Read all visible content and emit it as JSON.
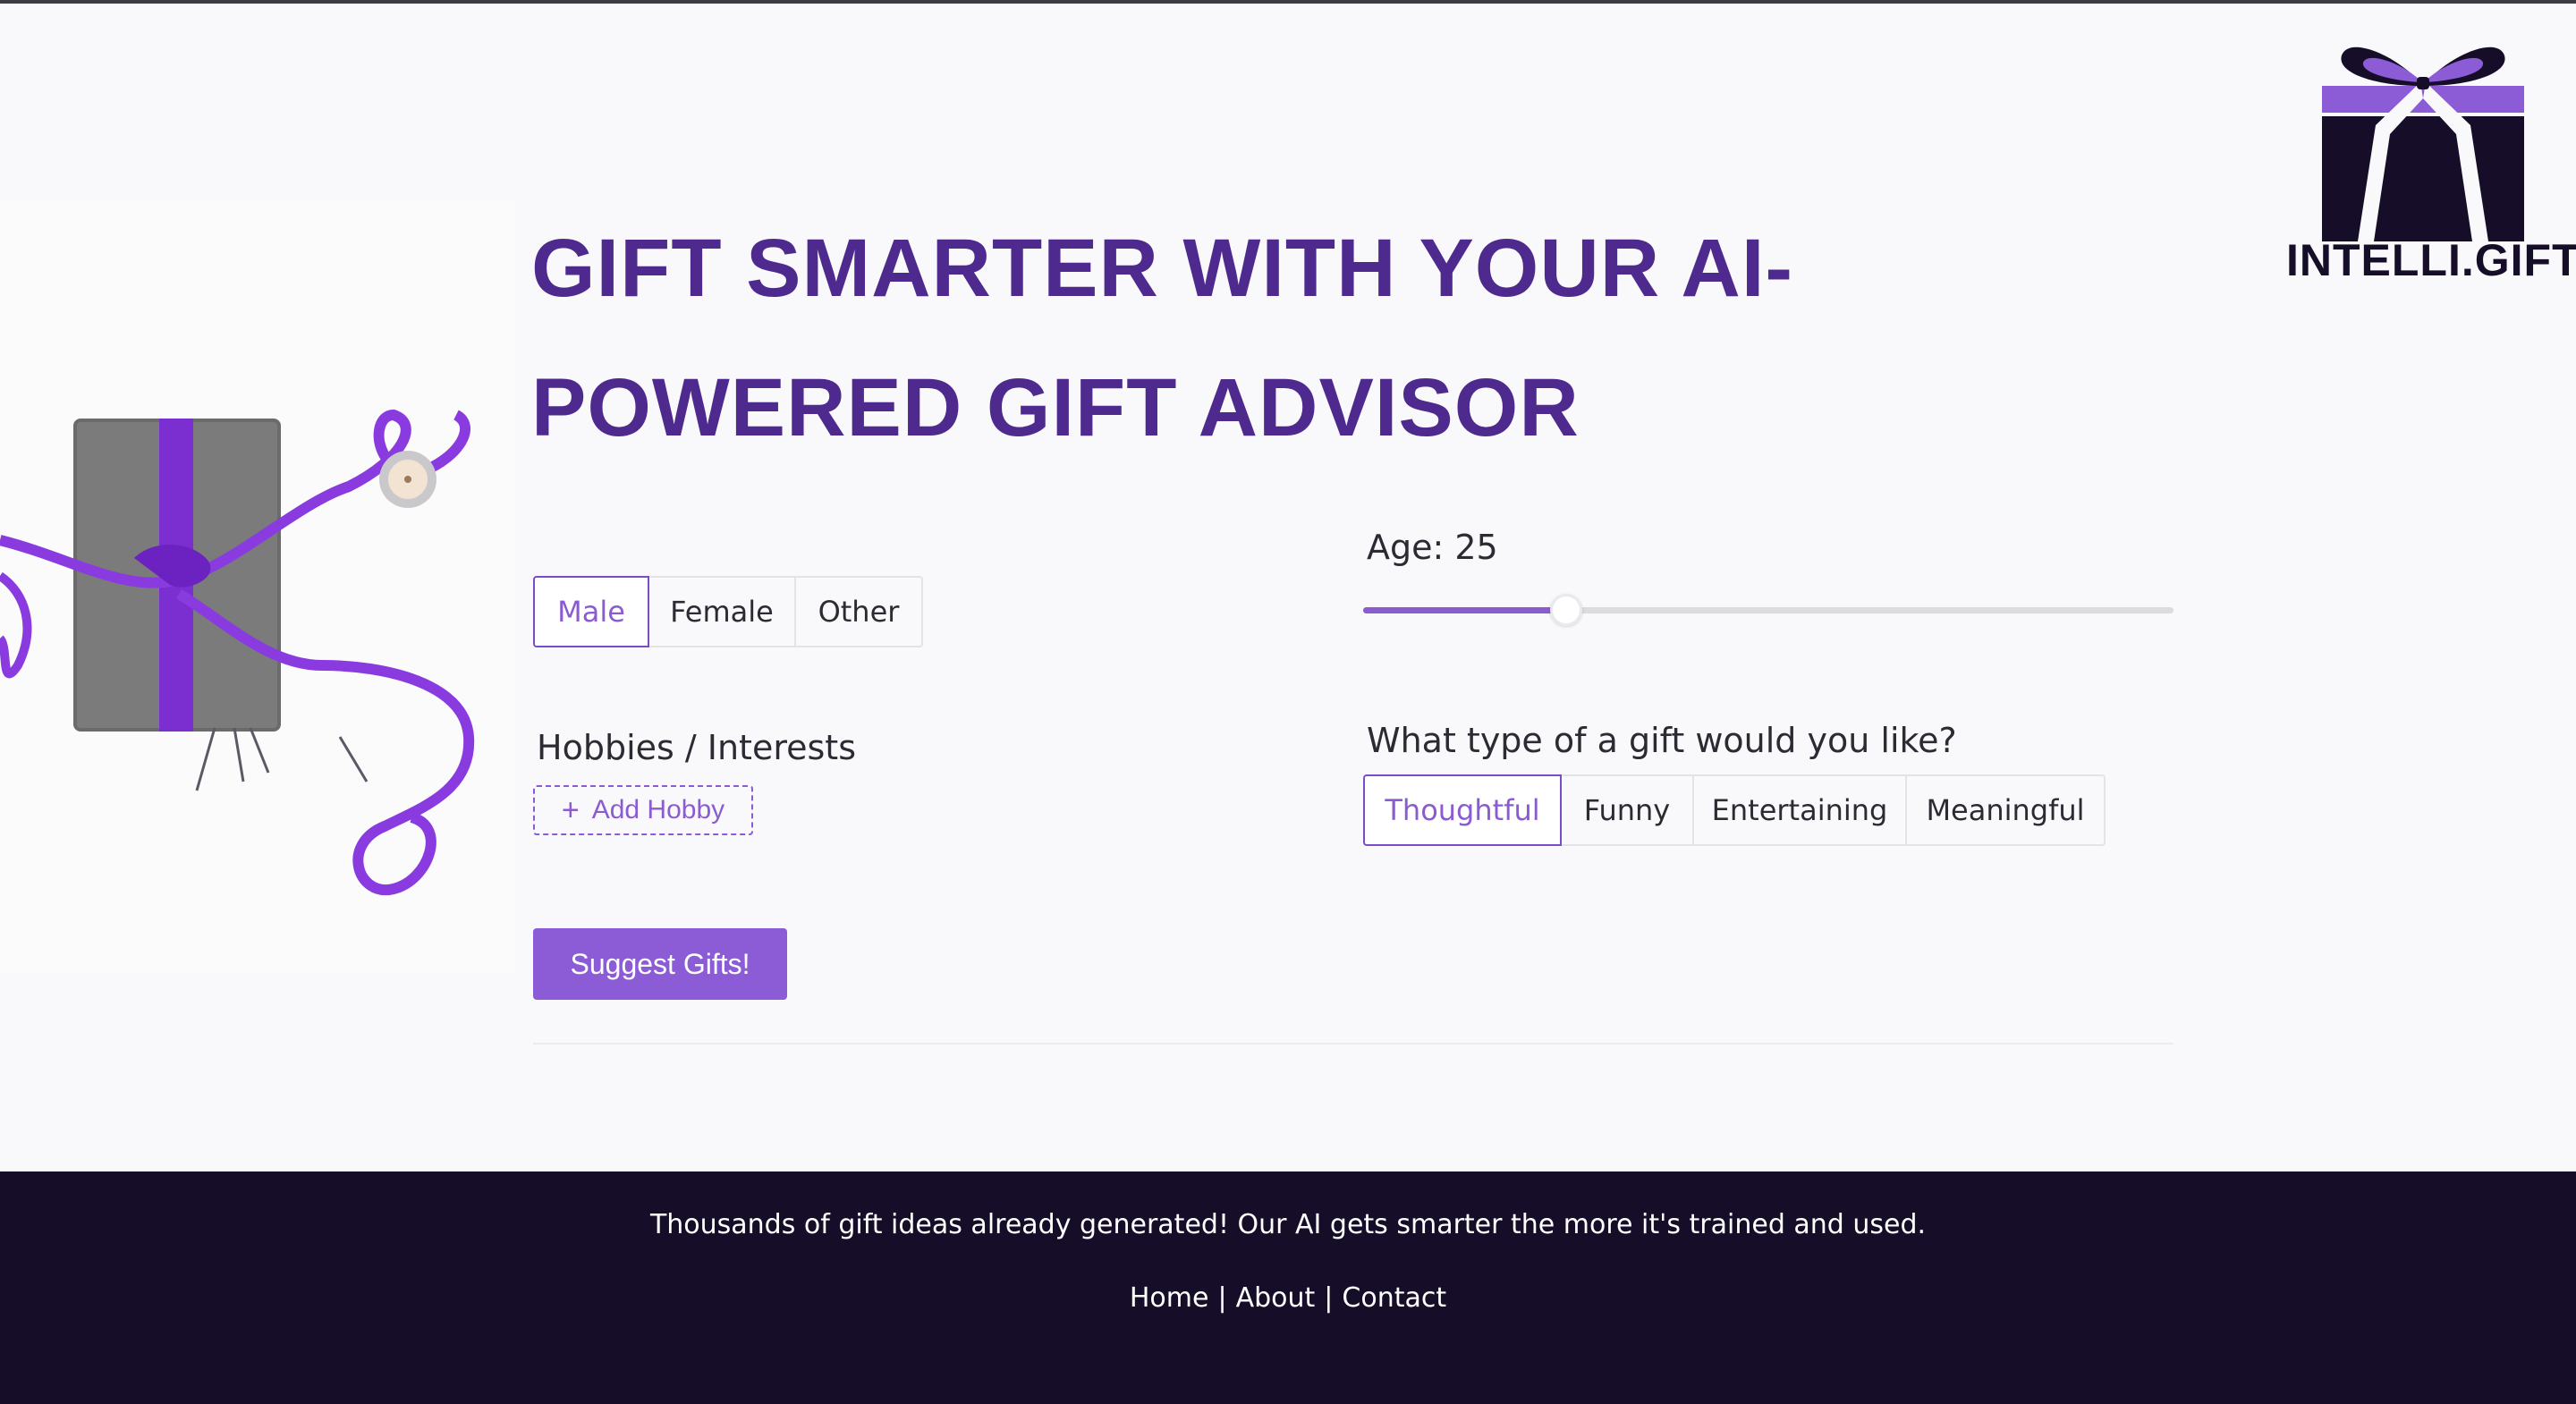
{
  "brand": {
    "logo_text": "INTELLI.GIFT",
    "color_primary": "#8b5cd6",
    "color_title": "#4e2a8e",
    "color_dark": "#160e28"
  },
  "hero": {
    "title": "GIFT SMARTER WITH YOUR AI-POWERED GIFT ADVISOR"
  },
  "form": {
    "gender": {
      "options": [
        "Male",
        "Female",
        "Other"
      ],
      "selected": "Male"
    },
    "age": {
      "label": "Age: 25",
      "value": 25,
      "fraction": 0.25
    },
    "hobbies": {
      "label": "Hobbies / Interests",
      "add_label": "Add Hobby"
    },
    "gift_type": {
      "label": "What type of a gift would you like?",
      "options": [
        "Thoughtful",
        "Funny",
        "Entertaining",
        "Meaningful"
      ],
      "selected": "Thoughtful"
    },
    "submit_label": "Suggest Gifts!"
  },
  "footer": {
    "tagline": "Thousands of gift ideas already generated! Our AI gets smarter the more it's trained and used.",
    "links": [
      "Home",
      "About",
      "Contact"
    ],
    "separator": "|"
  }
}
